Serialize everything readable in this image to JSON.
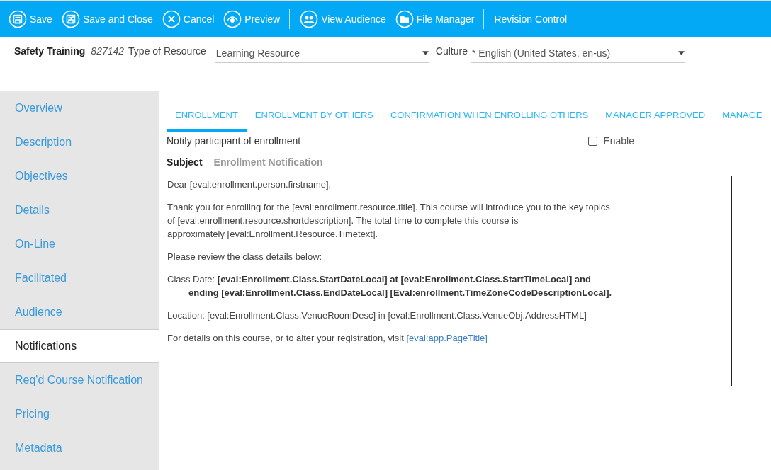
{
  "toolbar": [
    {
      "label": "Save",
      "kind": "save"
    },
    {
      "label": "Save and Close",
      "kind": "saveclose"
    },
    {
      "label": "Cancel",
      "kind": "cancel"
    },
    {
      "label": "Preview",
      "kind": "preview"
    },
    {
      "kind": "divider"
    },
    {
      "label": "View Audience",
      "kind": "audience"
    },
    {
      "label": "File Manager",
      "kind": "folder"
    },
    {
      "kind": "divider"
    },
    {
      "label": "Revision Control",
      "kind": "plain"
    }
  ],
  "header": {
    "title": "Safety Training",
    "id": "827142",
    "type_label": "Type of Resource",
    "type_value": "Learning Resource",
    "culture_label": "Culture",
    "culture_value": "* English (United States, en-us)"
  },
  "sidebar": {
    "items": [
      {
        "label": "Overview",
        "selected": false
      },
      {
        "label": "Description",
        "selected": false
      },
      {
        "label": "Objectives",
        "selected": false
      },
      {
        "label": "Details",
        "selected": false
      },
      {
        "label": "On-Line",
        "selected": false
      },
      {
        "label": "Facilitated",
        "selected": false
      },
      {
        "label": "Audience",
        "selected": false
      },
      {
        "label": "Notifications",
        "selected": true
      },
      {
        "label": "Req'd Course Notification",
        "selected": false
      },
      {
        "label": "Pricing",
        "selected": false
      },
      {
        "label": "Metadata",
        "selected": false
      }
    ]
  },
  "tabs": [
    {
      "label": "ENROLLMENT",
      "selected": true
    },
    {
      "label": "ENROLLMENT BY OTHERS",
      "selected": false
    },
    {
      "label": "CONFIRMATION WHEN ENROLLING OTHERS",
      "selected": false
    },
    {
      "label": "MANAGER APPROVED",
      "selected": false
    },
    {
      "label": "MANAGE",
      "selected": false
    }
  ],
  "notify_label": "Notify participant of enrollment",
  "enable": {
    "label": "Enable",
    "checked": false
  },
  "subject": {
    "label": "Subject",
    "value": "Enrollment Notification"
  },
  "body": [
    {
      "lines": [
        "Dear [eval:enrollment.person.firstname],"
      ]
    },
    {
      "lines": [
        "Thank you for enrolling for the [eval:enrollment.resource.title].  This course will introduce you to the key topics",
        "of [eval:enrollment.resource.shortdescription].  The total time to complete this course is",
        "approximately [eval:Enrollment.Resource.Timetext]."
      ]
    },
    {
      "lines": [
        "Please review the class details below:"
      ]
    },
    {
      "lines": [
        "Class Date:  **[eval:Enrollment.Class.StartDateLocal] at [eval:Enrollment.Class.StartTimeLocal] and**",
        "**ending [eval:Enrollment.Class.EndDateLocal] [Eval:enrollment.TimeZoneCodeDescriptionLocal].**"
      ]
    },
    {
      "lines": [
        "Location:   [eval:Enrollment.Class.VenueRoomDesc] in  [eval:Enrollment.Class.VenueObj.AddressHTML]"
      ]
    },
    {
      "lines": [
        "For details on this course, or to alter your registration, visit"
      ],
      "link": "[eval:app.PageTitle]"
    }
  ]
}
